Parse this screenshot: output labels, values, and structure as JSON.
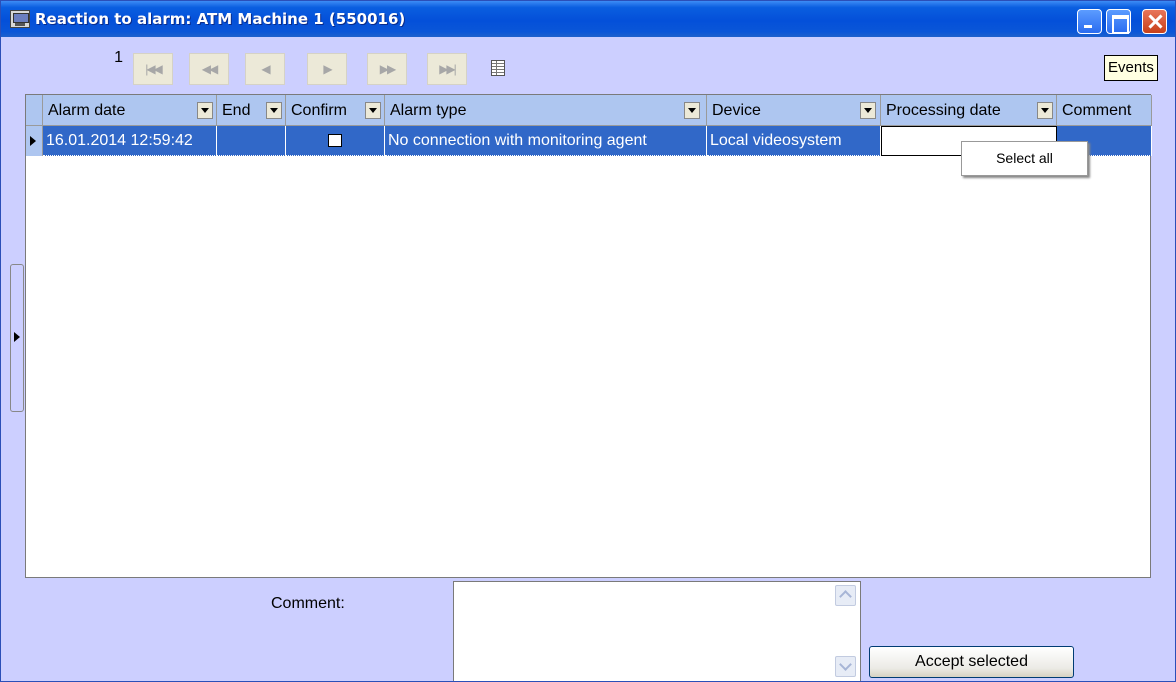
{
  "window": {
    "title": "Reaction to alarm: ATM Machine 1 (550016)",
    "controls": [
      "minimize-icon",
      "maximize-icon",
      "close-icon"
    ]
  },
  "navigator": {
    "page": "1",
    "buttons": [
      {
        "name": "first",
        "glyph": "|◀◀"
      },
      {
        "name": "prev-page",
        "glyph": "◀◀"
      },
      {
        "name": "prev",
        "glyph": "◀"
      },
      {
        "name": "next",
        "glyph": "▶"
      },
      {
        "name": "next-page",
        "glyph": "▶▶"
      },
      {
        "name": "last",
        "glyph": "▶▶|"
      }
    ],
    "tooltip": "Events"
  },
  "grid": {
    "columns": [
      "Alarm date",
      "End",
      "Confirm",
      "Alarm type",
      "Device",
      "Processing date",
      "Comment"
    ],
    "rows": [
      {
        "alarm_date": "16.01.2014 12:59:42",
        "end": "",
        "confirm": false,
        "alarm_type": "No connection with monitoring agent",
        "device": "Local videosystem",
        "processing_date": "",
        "comment": ""
      }
    ]
  },
  "context_menu": {
    "items": [
      "Select all"
    ]
  },
  "bottom": {
    "comment_label": "Comment:",
    "comment_value": "",
    "accept_label": "Accept selected"
  },
  "colors": {
    "titlebar": "#0450d9",
    "window_bg": "#cccfff",
    "selection": "#3168c8",
    "header": "#aec6f0"
  }
}
